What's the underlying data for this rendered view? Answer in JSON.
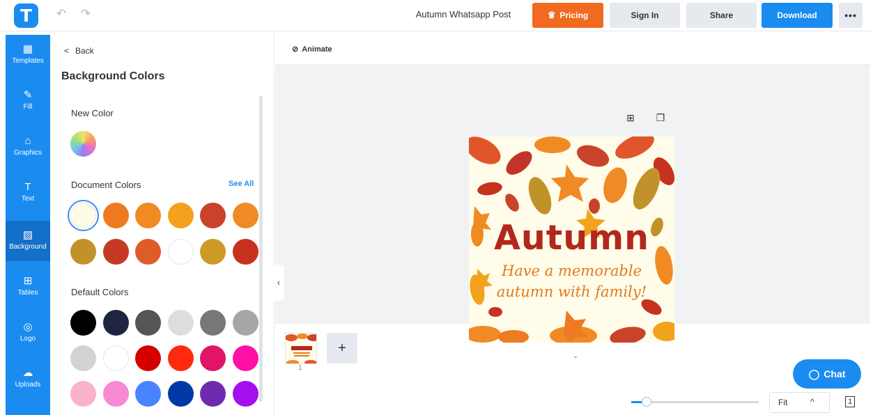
{
  "header": {
    "logo_letter": "T",
    "undo_icon": "↶",
    "redo_icon": "↷",
    "doc_title": "Autumn Whatsapp Post",
    "pricing_label": "Pricing",
    "signin_label": "Sign In",
    "share_label": "Share",
    "download_label": "Download",
    "more_label": "•••"
  },
  "sidebar": {
    "items": [
      {
        "label": "Templates",
        "icon": "templates-icon",
        "glyph": "▦"
      },
      {
        "label": "Fill",
        "icon": "pencil-icon",
        "glyph": "✎"
      },
      {
        "label": "Graphics",
        "icon": "shapes-icon",
        "glyph": "⌂"
      },
      {
        "label": "Text",
        "icon": "text-icon",
        "glyph": "T"
      },
      {
        "label": "Background",
        "icon": "background-icon",
        "glyph": "▨"
      },
      {
        "label": "Tables",
        "icon": "table-icon",
        "glyph": "⊞"
      },
      {
        "label": "Logo",
        "icon": "logo-icon",
        "glyph": "◎"
      },
      {
        "label": "Uploads",
        "icon": "cloud-upload-icon",
        "glyph": "☁"
      }
    ],
    "active": "Background"
  },
  "panel": {
    "back_label": "Back",
    "title": "Background Colors",
    "new_color_label": "New Color",
    "document_colors_label": "Document Colors",
    "see_all_label": "See All",
    "default_colors_label": "Default Colors",
    "document_colors": [
      "#fffbe6",
      "#ee7a21",
      "#f08a24",
      "#f2a21d",
      "#c9432a",
      "#f08a24",
      "#c2922a",
      "#c43a25",
      "#df5b2a",
      "#ffffff",
      "#cd9a25",
      "#c7321f"
    ],
    "default_colors": [
      "#000000",
      "#1e2540",
      "#555555",
      "#dcdddd",
      "#777777",
      "#a6a6a6",
      "#d3d3d3",
      "#ffffff",
      "#d40000",
      "#ff2a0c",
      "#e01565",
      "#ff0fa6",
      "#f9b3c8",
      "#f78ad5",
      "#4a83ff",
      "#0038a8",
      "#6f2bb0",
      "#a40ff0"
    ],
    "selected_document_color": 0
  },
  "toolbar": {
    "animate_label": "Animate",
    "animate_icon": "⊘"
  },
  "stage": {
    "add_icon": "⊞",
    "copy_icon": "❐",
    "collapse_left": "‹",
    "collapse_bottom": "⌄"
  },
  "design": {
    "headline": "Autumn",
    "subline_1": "Have a memorable",
    "subline_2": "autumn with family!",
    "background": "#fffcea",
    "headline_color": "#b3281c",
    "subline_color": "#e07a1f"
  },
  "pages": {
    "page_number": "1",
    "add_page_label": "+"
  },
  "footer": {
    "chat_label": "Chat",
    "zoom_value": "Fit",
    "zoom_chevron": "^",
    "zoom_level": 0.12,
    "pages_icon": "1"
  }
}
